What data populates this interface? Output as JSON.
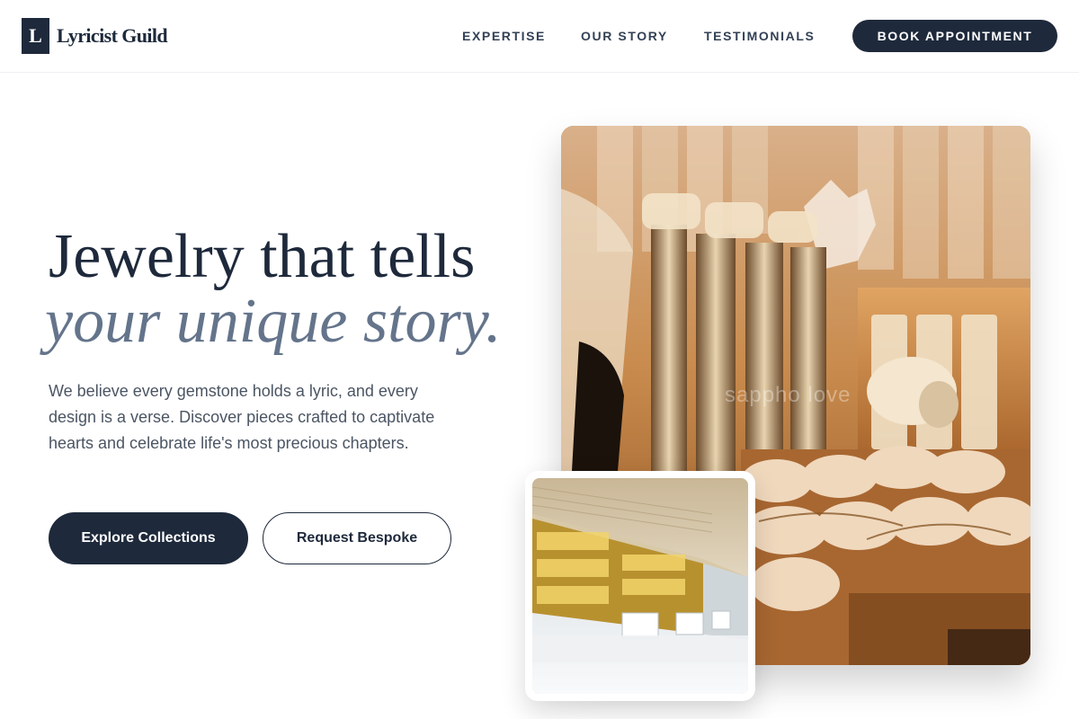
{
  "brand": {
    "logo_letter": "L",
    "name": "Lyricist Guild",
    "color": "#1e293b"
  },
  "nav": {
    "items": [
      {
        "label": "EXPERTISE"
      },
      {
        "label": "OUR STORY"
      },
      {
        "label": "TESTIMONIALS"
      }
    ],
    "cta_label": "BOOK APPOINTMENT"
  },
  "hero": {
    "title_line1": "Jewelry that tells",
    "title_line2": "your unique story.",
    "subtitle": "We believe every gemstone holds a lyric, and every design is a verse. Discover pieces crafted to captivate hearts and celebrate life's most precious chapters.",
    "primary_button": "Explore Collections",
    "secondary_button": "Request Bespoke"
  },
  "images": {
    "main_alt_icon": "jewelry-display-photo",
    "main_watermark": "sappho love",
    "secondary_alt_icon": "jewelry-store-interior-photo"
  },
  "colors": {
    "accent": "#1e293b",
    "italic_title": "#64748b",
    "body_text": "#4b5563"
  }
}
